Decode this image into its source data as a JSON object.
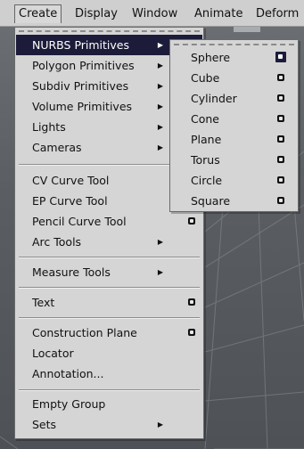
{
  "menubar": {
    "items": [
      "Create",
      "Display",
      "Window",
      "Animate",
      "Deform"
    ]
  },
  "create_menu": {
    "items": [
      {
        "label": "NURBS Primitives",
        "submenu": true,
        "selected": true
      },
      {
        "label": "Polygon Primitives",
        "submenu": true
      },
      {
        "label": "Subdiv Primitives",
        "submenu": true
      },
      {
        "label": "Volume Primitives",
        "submenu": true
      },
      {
        "label": "Lights",
        "submenu": true
      },
      {
        "label": "Cameras",
        "submenu": true
      },
      {
        "label": "CV Curve Tool"
      },
      {
        "label": "EP Curve Tool"
      },
      {
        "label": "Pencil Curve Tool",
        "option_box": true
      },
      {
        "label": "Arc Tools",
        "submenu": true
      },
      {
        "label": "Measure Tools",
        "submenu": true
      },
      {
        "label": "Text",
        "option_box": true
      },
      {
        "label": "Construction Plane",
        "option_box": true
      },
      {
        "label": "Locator"
      },
      {
        "label": "Annotation..."
      },
      {
        "label": "Empty Group"
      },
      {
        "label": "Sets",
        "submenu": true
      }
    ]
  },
  "nurbs_submenu": {
    "items": [
      {
        "label": "Sphere",
        "option_box": true,
        "selected_option": true
      },
      {
        "label": "Cube",
        "option_box": true
      },
      {
        "label": "Cylinder",
        "option_box": true
      },
      {
        "label": "Cone",
        "option_box": true
      },
      {
        "label": "Plane",
        "option_box": true
      },
      {
        "label": "Torus",
        "option_box": true
      },
      {
        "label": "Circle",
        "option_box": true
      },
      {
        "label": "Square",
        "option_box": true
      }
    ]
  },
  "icons": {
    "submenu_arrow": "submenu-arrow-icon",
    "option_box": "option-box-icon"
  },
  "colors": {
    "selection": "#1c1c3a",
    "menu_bg": "#d5d5d5",
    "viewport": "#5e6266"
  }
}
